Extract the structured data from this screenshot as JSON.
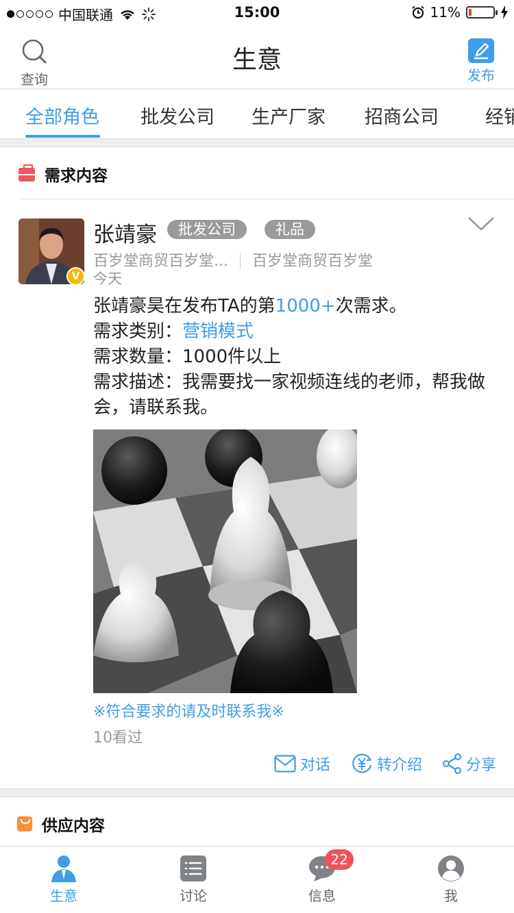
{
  "status_bar": {
    "carrier": "中国联通",
    "time": "15:00",
    "battery": "11%",
    "battery_level_percent": 11
  },
  "nav": {
    "search_label": "查询",
    "title": "生意",
    "publish_label": "发布"
  },
  "tabs": [
    {
      "label": "全部角色",
      "active": true
    },
    {
      "label": "批发公司",
      "active": false
    },
    {
      "label": "生产厂家",
      "active": false
    },
    {
      "label": "招商公司",
      "active": false
    },
    {
      "label": "经销",
      "active": false
    }
  ],
  "demand_section": {
    "title": "需求内容",
    "post": {
      "user_name": "张靖豪",
      "verified_badge": "V",
      "tags": [
        "批发公司",
        "礼品"
      ],
      "company_short": "百岁堂商贸百岁堂...",
      "company_full": "百岁堂商贸百岁堂",
      "time": "今天",
      "line1_prefix": "张靖豪昊在发布TA的第",
      "line1_count": "1000+",
      "line1_suffix": "次需求。",
      "category_label": "需求类别：",
      "category_value": "营销模式",
      "quantity_label": "需求数量：",
      "quantity_value": "1000件以上",
      "description_label": "需求描述：",
      "description_value": "我需要找一家视频连线的老师，帮我做会，请联系我。",
      "notice": "※符合要求的请及时联系我※",
      "views": "10看过",
      "actions": {
        "chat": "对话",
        "refer": "转介绍",
        "share": "分享"
      }
    }
  },
  "supply_section": {
    "title": "供应内容"
  },
  "bottom_tabs": [
    {
      "label": "生意",
      "active": true
    },
    {
      "label": "讨论",
      "active": false
    },
    {
      "label": "信息",
      "active": false,
      "badge": "22"
    },
    {
      "label": "我",
      "active": false
    }
  ],
  "colors": {
    "accent": "#3e9ee8",
    "tag_gray": "#9a9a9a",
    "badge_red": "#f2525a",
    "verified_gold": "#f5b800"
  }
}
